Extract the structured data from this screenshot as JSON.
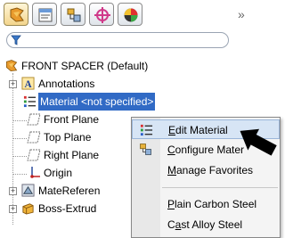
{
  "toolbar": {
    "tabs": [
      {
        "name": "feature-manager-tab"
      },
      {
        "name": "property-manager-tab"
      },
      {
        "name": "configuration-manager-tab"
      },
      {
        "name": "dim-xpert-tab"
      },
      {
        "name": "display-manager-tab"
      }
    ],
    "more_label": "»"
  },
  "tree": {
    "root": "FRONT SPACER  (Default)",
    "items": [
      {
        "label": "Annotations"
      },
      {
        "label": "Material <not specified>"
      },
      {
        "label": "Front Plane"
      },
      {
        "label": "Top Plane"
      },
      {
        "label": "Right Plane"
      },
      {
        "label": "Origin"
      },
      {
        "label": "MateReferen"
      },
      {
        "label": "Boss-Extrud"
      }
    ]
  },
  "context_menu": {
    "items": [
      {
        "prefix": "",
        "accel": "E",
        "rest": "dit Material"
      },
      {
        "prefix": "",
        "accel": "C",
        "rest": "onfigure Mater"
      },
      {
        "prefix": "",
        "accel": "M",
        "rest": "anage Favorites"
      },
      {
        "prefix": "",
        "accel": "P",
        "rest": "lain Carbon Steel"
      },
      {
        "prefix": "C",
        "accel": "a",
        "rest": "st Alloy Steel"
      }
    ]
  },
  "colors": {
    "selection": "#316ac5",
    "menu_hover": "#d7e5f5"
  }
}
